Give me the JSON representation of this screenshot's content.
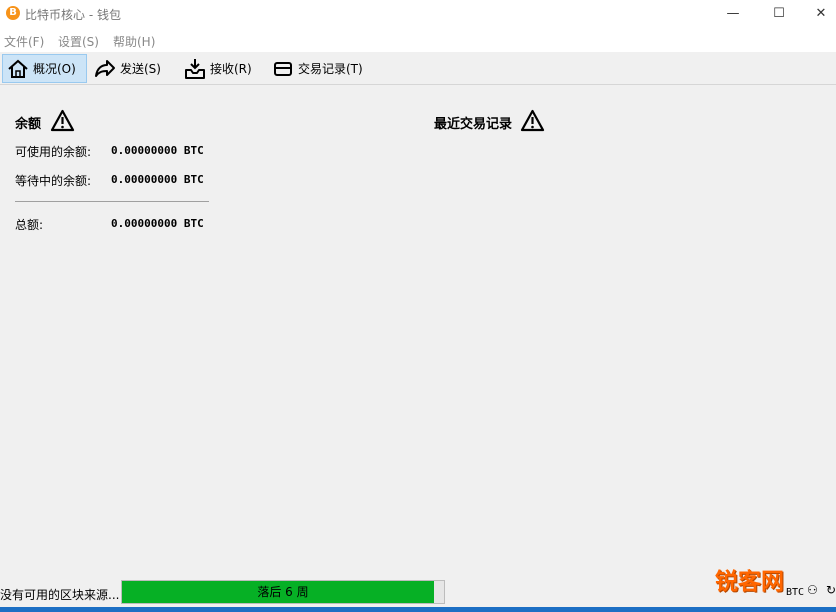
{
  "window": {
    "title": "比特币核心 - 钱包",
    "app_icon_glyph": "B",
    "controls": {
      "minimize": "—",
      "maximize": "☐",
      "close": "✕"
    }
  },
  "menu": {
    "items": [
      "文件(F)",
      "设置(S)",
      "帮助(H)"
    ]
  },
  "toolbar": {
    "tabs": [
      {
        "label": "概况(O)",
        "icon": "home-icon",
        "active": true
      },
      {
        "label": "发送(S)",
        "icon": "send-arrow-icon",
        "active": false
      },
      {
        "label": "接收(R)",
        "icon": "receive-tray-icon",
        "active": false
      },
      {
        "label": "交易记录(T)",
        "icon": "card-icon",
        "active": false
      }
    ]
  },
  "overview": {
    "balance_title": "余额",
    "recent_title": "最近交易记录",
    "available_label": "可使用的余额:",
    "available_value": "0.00000000 BTC",
    "pending_label": "等待中的余额:",
    "pending_value": "0.00000000 BTC",
    "total_label": "总额:",
    "total_value": "0.00000000 BTC"
  },
  "status": {
    "text": "没有可用的区块来源...",
    "progress_text": "落后 6 周",
    "progress_percent": 97,
    "unit": "BTC"
  },
  "watermark": "锐客网",
  "colors": {
    "progress": "#06b025",
    "active_tab": "#cce4f7",
    "bitcoin": "#f7931a"
  }
}
